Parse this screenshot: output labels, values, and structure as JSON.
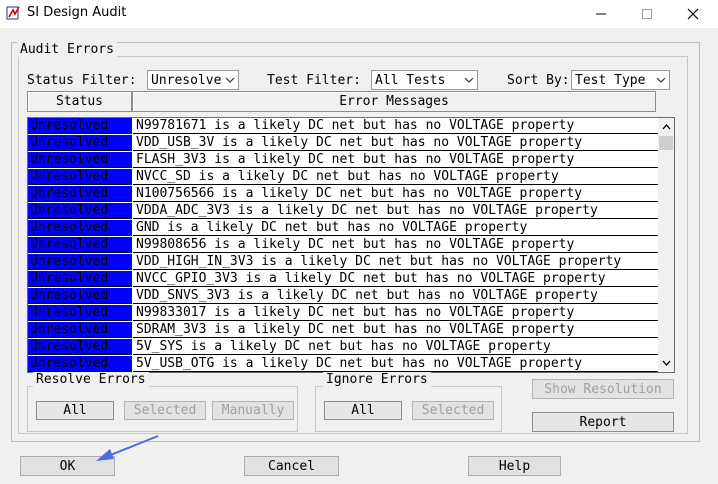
{
  "window": {
    "title": "SI Design Audit"
  },
  "audit_errors": {
    "group_label": "Audit Errors",
    "status_filter_label": "Status Filter:",
    "status_filter_value": "Unresolve",
    "test_filter_label": "Test Filter:",
    "test_filter_value": "All Tests",
    "sort_by_label": "Sort By:",
    "sort_by_value": "Test Type",
    "columns": [
      "Status",
      "Error Messages"
    ],
    "rows": [
      {
        "status": "Unresolved",
        "message": "N99781671 is a likely DC net but has no VOLTAGE property"
      },
      {
        "status": "Unresolved",
        "message": "VDD_USB_3V is a likely DC net but has no VOLTAGE property"
      },
      {
        "status": "Unresolved",
        "message": "FLASH_3V3 is a likely DC net but has no VOLTAGE property"
      },
      {
        "status": "Unresolved",
        "message": "NVCC_SD is a likely DC net but has no VOLTAGE property"
      },
      {
        "status": "Unresolved",
        "message": "N100756566 is a likely DC net but has no VOLTAGE property"
      },
      {
        "status": "Unresolved",
        "message": "VDDA_ADC_3V3 is a likely DC net but has no VOLTAGE property"
      },
      {
        "status": "Unresolved",
        "message": "GND is a likely DC net but has no VOLTAGE property"
      },
      {
        "status": "Unresolved",
        "message": "N99808656 is a likely DC net but has no VOLTAGE property"
      },
      {
        "status": "Unresolved",
        "message": "VDD_HIGH_IN_3V3 is a likely DC net but has no VOLTAGE property"
      },
      {
        "status": "Unresolved",
        "message": "NVCC_GPIO_3V3 is a likely DC net but has no VOLTAGE property"
      },
      {
        "status": "Unresolved",
        "message": "VDD_SNVS_3V3 is a likely DC net but has no VOLTAGE property"
      },
      {
        "status": "Unresolved",
        "message": "N99833017 is a likely DC net but has no VOLTAGE property"
      },
      {
        "status": "Unresolved",
        "message": "SDRAM_3V3 is a likely DC net but has no VOLTAGE property"
      },
      {
        "status": "Unresolved",
        "message": "5V_SYS is a likely DC net but has no VOLTAGE property"
      },
      {
        "status": "Unresolved",
        "message": "5V_USB_OTG is a likely DC net but has no VOLTAGE property"
      }
    ]
  },
  "resolve_errors": {
    "group_label": "Resolve Errors",
    "all_label": "All",
    "selected_label": "Selected",
    "manually_label": "Manually"
  },
  "ignore_errors": {
    "group_label": "Ignore Errors",
    "all_label": "All",
    "selected_label": "Selected"
  },
  "side_buttons": {
    "show_resolution_label": "Show Resolution",
    "report_label": "Report"
  },
  "footer": {
    "ok_label": "OK",
    "cancel_label": "Cancel",
    "help_label": "Help"
  },
  "colors": {
    "status_cell_bg": "#0000ff",
    "window_bg": "#f0f0f0",
    "arrow": "#4a6ee0"
  }
}
